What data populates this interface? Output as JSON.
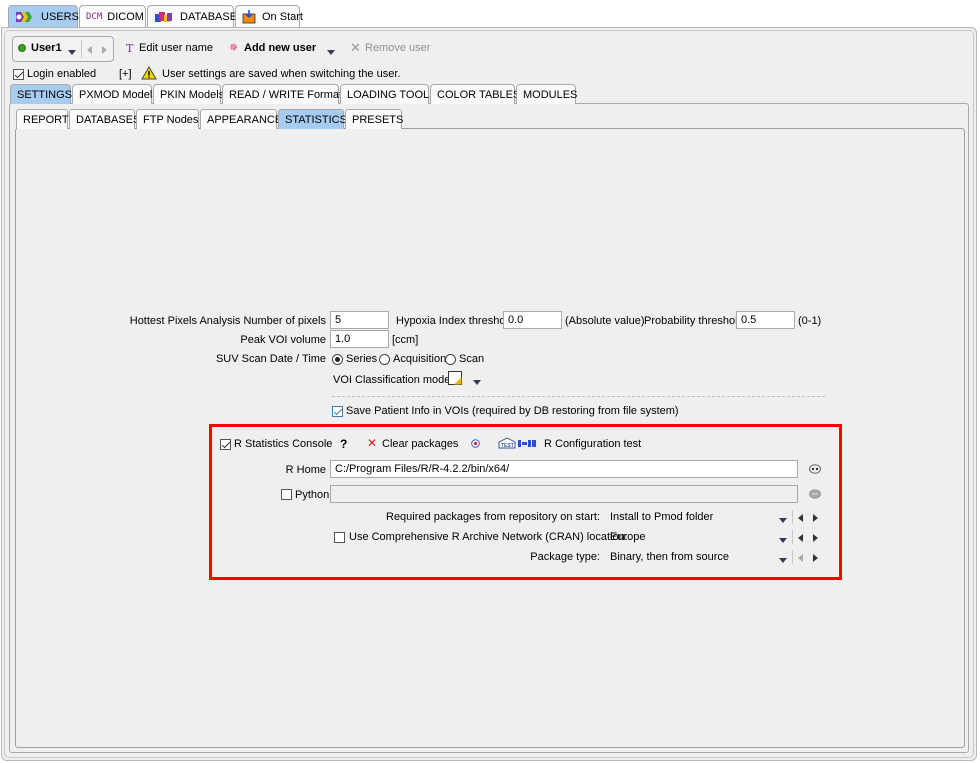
{
  "top_tabs": [
    {
      "label": "USERS",
      "icon": "users-icon",
      "active": true
    },
    {
      "label": "DICOM",
      "icon": "dcm-icon",
      "icon_text": "DCM",
      "active": false
    },
    {
      "label": "DATABASE",
      "icon": "database-icon",
      "active": false
    },
    {
      "label": "On Start",
      "icon": "on-start-icon",
      "active": false
    }
  ],
  "user_toolbar": {
    "current_user": "User1",
    "user_status_color": "#3aa317",
    "edit_user_name": "Edit user name",
    "add_new_user": "Add new user",
    "remove_user": "Remove user"
  },
  "login": {
    "login_enabled_label": "Login enabled",
    "login_enabled": true,
    "expand_label": "[+]",
    "warning_text": "User settings are saved when switching the user."
  },
  "settings_tabs": [
    {
      "label": "SETTINGS",
      "active": true
    },
    {
      "label": "PXMOD Models",
      "active": false
    },
    {
      "label": "PKIN Models",
      "active": false
    },
    {
      "label": "READ / WRITE Formats",
      "active": false
    },
    {
      "label": "LOADING TOOLS",
      "active": false
    },
    {
      "label": "COLOR TABLES",
      "active": false
    },
    {
      "label": "MODULES",
      "active": false
    }
  ],
  "sub_tabs": [
    {
      "label": "REPORT",
      "active": false
    },
    {
      "label": "DATABASES",
      "active": false
    },
    {
      "label": "FTP Nodes",
      "active": false
    },
    {
      "label": "APPEARANCE",
      "active": false
    },
    {
      "label": "STATISTICS",
      "active": true
    },
    {
      "label": "PRESETS",
      "active": false
    }
  ],
  "statistics": {
    "hottest_pixels_label": "Hottest Pixels Analysis Number of pixels",
    "hottest_pixels_value": "5",
    "hypoxia_label": "Hypoxia Index threshold",
    "hypoxia_value": "0.0",
    "hypoxia_unit": "(Absolute value)",
    "probability_label": "Probability threshold",
    "probability_value": "0.5",
    "probability_unit": "(0-1)",
    "peak_voi_label": "Peak VOI volume",
    "peak_voi_value": "1.0",
    "peak_voi_unit": "[ccm]",
    "suv_label": "SUV Scan Date / Time",
    "suv_options": [
      "Series",
      "Acquisition",
      "Scan"
    ],
    "suv_selected": "Series",
    "voi_class_label": "VOI Classification mode:",
    "save_patient_info_label": "Save Patient Info in VOIs (required by DB restoring from file system)",
    "save_patient_info": true
  },
  "r_section": {
    "r_console_label": "R Statistics Console",
    "r_console_checked": true,
    "help_label": "?",
    "clear_packages_label": "Clear packages",
    "r_config_test_label": "R Configuration test",
    "test_icon_text": "TEST",
    "r_home_label": "R Home",
    "r_home_value": "C:/Program Files/R/R-4.2.2/bin/x64/",
    "python_label": "Python",
    "python_checked": false,
    "python_value": "",
    "required_packages_label": "Required packages from repository on start:",
    "required_packages_value": "Install to Pmod folder",
    "cran_label": "Use Comprehensive R Archive Network (CRAN) location:",
    "cran_checked": false,
    "cran_value": "Europe",
    "package_type_label": "Package type:",
    "package_type_value": "Binary, then from source"
  },
  "colors": {
    "active_tab": "#a6cdf1",
    "highlight": "#ff0000",
    "clear_icon": "#d62020"
  }
}
